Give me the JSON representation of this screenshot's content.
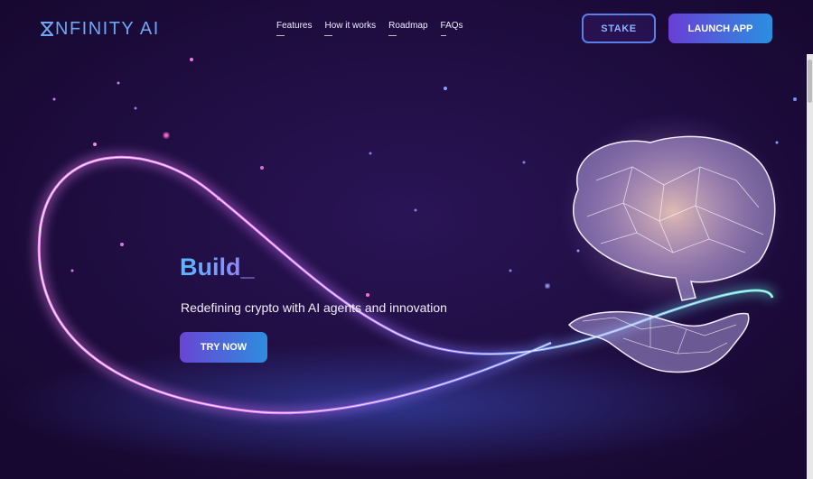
{
  "brand": {
    "logo_text": "NFINITY AI",
    "logo_icon": "hourglass-x-icon"
  },
  "nav": {
    "items": [
      {
        "label": "Features"
      },
      {
        "label": "How it works"
      },
      {
        "label": "Roadmap"
      },
      {
        "label": "FAQs"
      }
    ]
  },
  "actions": {
    "stake_label": "STAKE",
    "launch_label": "LAUNCH APP"
  },
  "hero": {
    "title": "Build_",
    "subtitle": "Redefining crypto with AI agents and innovation",
    "cta_label": "TRY NOW"
  },
  "colors": {
    "background": "#1d0c3a",
    "accent_blue": "#2e8de0",
    "accent_purple": "#6845d4",
    "glow_pink": "#e879f9"
  },
  "illustration": {
    "subject": "glowing-brain-over-hand",
    "ribbon": "infinity-light-ribbon"
  }
}
